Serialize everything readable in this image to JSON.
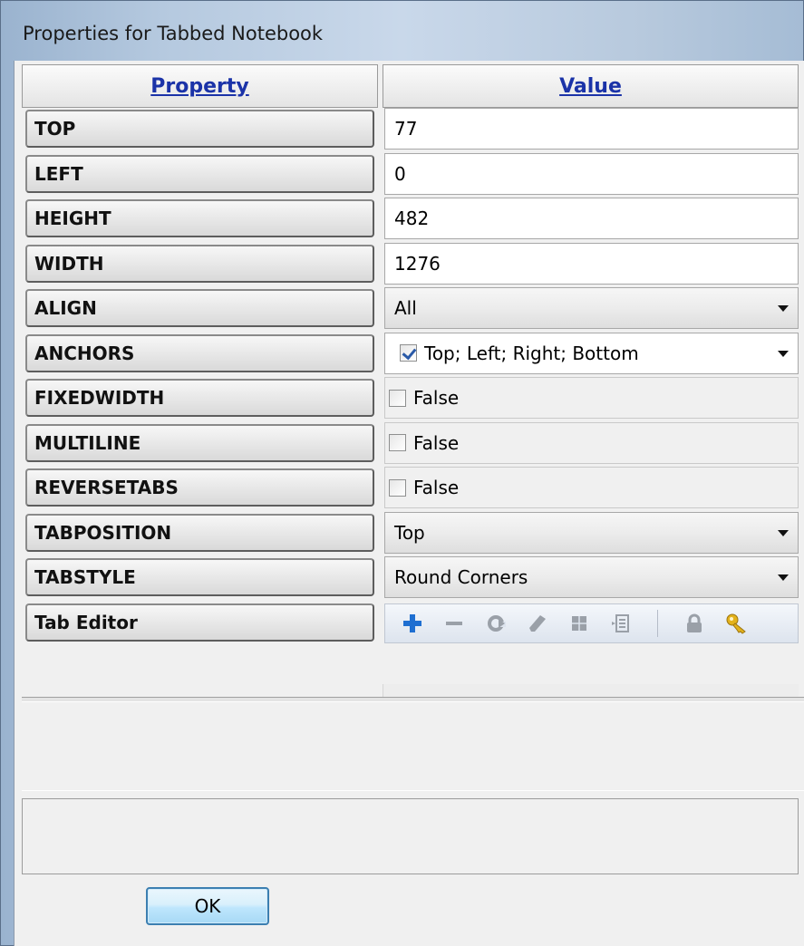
{
  "window": {
    "title": "Properties for Tabbed Notebook"
  },
  "grid": {
    "header_property": "Property",
    "header_value": "Value",
    "rows": [
      {
        "name": "TOP",
        "kind": "input",
        "value": "77"
      },
      {
        "name": "LEFT",
        "kind": "input",
        "value": "0"
      },
      {
        "name": "HEIGHT",
        "kind": "input",
        "value": "482"
      },
      {
        "name": "WIDTH",
        "kind": "input",
        "value": "1276"
      },
      {
        "name": "ALIGN",
        "kind": "combo",
        "value": "All"
      },
      {
        "name": "ANCHORS",
        "kind": "anchors",
        "value": "Top; Left; Right; Bottom"
      },
      {
        "name": "FIXEDWIDTH",
        "kind": "check",
        "value": "False"
      },
      {
        "name": "MULTILINE",
        "kind": "check",
        "value": "False"
      },
      {
        "name": "REVERSETABS",
        "kind": "check",
        "value": "False"
      },
      {
        "name": "TABPOSITION",
        "kind": "combo",
        "value": "Top"
      },
      {
        "name": "TABSTYLE",
        "kind": "combo",
        "value": "Round Corners"
      },
      {
        "name": "Tab Editor",
        "kind": "toolbar",
        "value": ""
      }
    ]
  },
  "tab_editor_toolbar": {
    "icons": [
      "add-icon",
      "remove-icon",
      "undo-icon",
      "edit-icon",
      "grid-icon",
      "properties-icon",
      "lock-icon",
      "key-icon"
    ]
  },
  "footer": {
    "ok_label": "OK"
  }
}
